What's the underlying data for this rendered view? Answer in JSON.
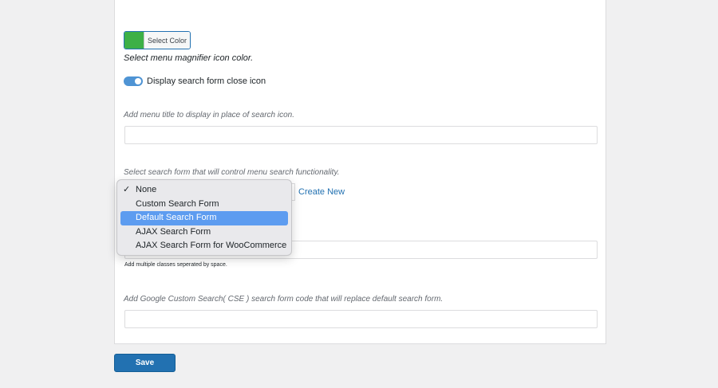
{
  "color_picker": {
    "label": "Select Color",
    "swatch_color": "#3db046",
    "description": "Select menu magnifier icon color."
  },
  "close_icon_toggle": {
    "label": "Display search form close icon",
    "enabled": true
  },
  "menu_title": {
    "description": "Add menu title to display in place of search icon.",
    "value": ""
  },
  "search_form": {
    "description": "Select search form that will control menu search functionality.",
    "checked_option": "None",
    "highlighted_option": "Default Search Form",
    "options": [
      "None",
      "Custom Search Form",
      "Default Search Form",
      "AJAX Search Form",
      "AJAX Search Form for WooCommerce"
    ],
    "create_new_label": "Create New"
  },
  "css_classes": {
    "help": "Add multiple classes seperated by space.",
    "value": ""
  },
  "google_cse": {
    "description": "Add Google Custom Search( CSE ) search form code that will replace default search form.",
    "value": ""
  },
  "save_button": {
    "label": "Save"
  }
}
